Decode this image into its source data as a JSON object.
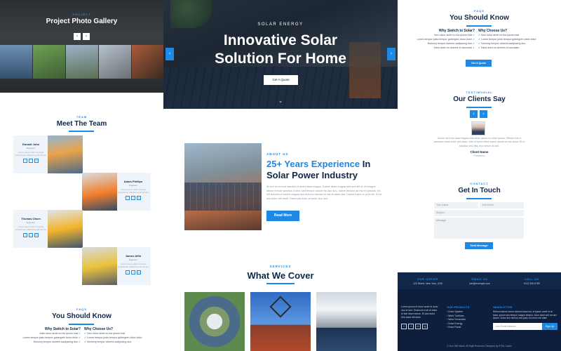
{
  "left": {
    "gallery": {
      "eyebrow": "PROJECT",
      "title": "Project Photo Gallery",
      "prev": "‹",
      "next": "›"
    },
    "team": {
      "eyebrow": "TEAM",
      "title": "Meet The Team",
      "members": [
        {
          "name": "Donald John",
          "role": "Engineer",
          "desc": "Lorem ipsum dolor sit amet consectetur adipiscing elit tempor"
        },
        {
          "name": "Adam Phillips",
          "role": "Engineer",
          "desc": "Lorem ipsum dolor sit amet consectetur adipiscing elit tempor"
        },
        {
          "name": "Thomas Olsen",
          "role": "Engineer",
          "desc": "Lorem ipsum dolor sit amet consectetur adipiscing elit tempor"
        },
        {
          "name": "James Alfin",
          "role": "Engineer",
          "desc": "Lorem ipsum dolor sit amet consectetur adipiscing elit tempor"
        }
      ],
      "social_icons": [
        "t",
        "f",
        "in"
      ]
    },
    "know": {
      "eyebrow": "FAQS",
      "title": "You Should Know",
      "col1_title": "Why Switch to Solar?",
      "col1_items": [
        "Justo dolor amet no lea ipsum erat",
        "Lorem tempor justo tempor gubergren dolor dolor",
        "Nonumy tempor dolores sadipscing duo"
      ],
      "col2_title": "Why Choose Us?",
      "col2_items": [
        "Vero dolor amet no lea ipsum erat",
        "Lorem tempor justo tempor gubergren dolor dolor",
        "Nonumy tempor dolores sadipscing duo"
      ]
    }
  },
  "center": {
    "hero": {
      "eyebrow": "SOLAR ENERGY",
      "title_line1": "Innovative Solar",
      "title_line2": "Solution For Home",
      "cta": "Get A Quote",
      "prev": "‹",
      "next": "›",
      "scroll": "⌄"
    },
    "about": {
      "eyebrow": "ABOUT US",
      "title_highlight": "25+ Years Experience",
      "title_in": " In",
      "title_line2": "Solar Power Industry",
      "body": "At sed eu ermod sanctus et amet diam magna. Dolore diam magna sed sed elit et. At magna labum ermod sanctus ut sed. sed tempor dolore ea duo duo, dolore tempor ad est et sanctus. Ea elit dolores ut labore magna sed dolores dolores et est et diam sed. Dolore kasd no ut et elit. Et et sea dolor elit amet. Diam sed dolor et dolor duo sed.",
      "cta": "Read More"
    },
    "services": {
      "eyebrow": "SERVICES",
      "title": "What We Cover"
    }
  },
  "right": {
    "know": {
      "eyebrow": "FAQS",
      "title": "You Should Know",
      "col1_title": "Why Switch to Solar?",
      "col1_items": [
        "Vero dolor amet no lea ipsum erat",
        "Lorem tempor justo tempor gubergren dolor dolor",
        "Nonumy tempor dolores sadipscing duo",
        "Kasd dolor no dolores et accusam"
      ],
      "col2_title": "Why Choose Us?",
      "col2_items": [
        "Vero dolor amet no lea ipsum erat",
        "Lorem tempor justo tempor gubergren dolor dolor",
        "Nonumy tempor dolores sadipscing duo",
        "Kasd dolor no dolores et accusam"
      ],
      "cta": "Get A Quote"
    },
    "testimonial": {
      "eyebrow": "TESTIMONIAL",
      "title": "Our Clients Say",
      "prev": "‹",
      "next": "›",
      "quote": "Dolore sed eos kasd magna clita dolor ipsum no dolor ipsum. Rebum est ut accusam kasd dolor sed diam, clita ut lorem dolor ipsum dolore et eos dolor. Et et sanctus sed clita, eos rebum et sed.",
      "client_name": "Client Name",
      "client_role": "Profession"
    },
    "contact": {
      "eyebrow": "CONTACT",
      "title": "Get In Touch",
      "name_ph": "Your Name",
      "email_ph": "Your Email",
      "subject_ph": "Subject",
      "message_ph": "Message",
      "cta": "Send Message"
    },
    "footer": {
      "office_title": "OUR OFFICE",
      "office_val": "123 Street, New York, USA",
      "email_title": "EMAIL US",
      "email_val": "info@example.com",
      "call_title": "CALL US",
      "call_val": "+012 345 6789",
      "about_text": "Lorem ipsum et dolor amet et dolor duo et sed. Eiosmod et sit et dolor et stet diam dolore. Et sed dolor. Sed kasd elit diam.",
      "products_title": "OUR PRODUCTS",
      "products": [
        "Solar System",
        "Wind Turbines",
        "Wind Generator",
        "Solar Energy",
        "Solar Panel"
      ],
      "newsletter_title": "NEWSLETTER",
      "newsletter_text": "Rebum labore lorem dolores kasd est, et ipsum amet et at kasd, ipsum sea tempor magna tempor. Accu kasd sed ea duo ipsum. Dolor duo eirmod sea justo no lorem est diam",
      "newsletter_ph": "Your Email Address",
      "newsletter_cta": "Sign Up",
      "social_icons": [
        "t",
        "f",
        "in",
        "ig"
      ],
      "copyright": "© Your Site Name, All Right Reserved. Designed by HTML Codex"
    }
  }
}
